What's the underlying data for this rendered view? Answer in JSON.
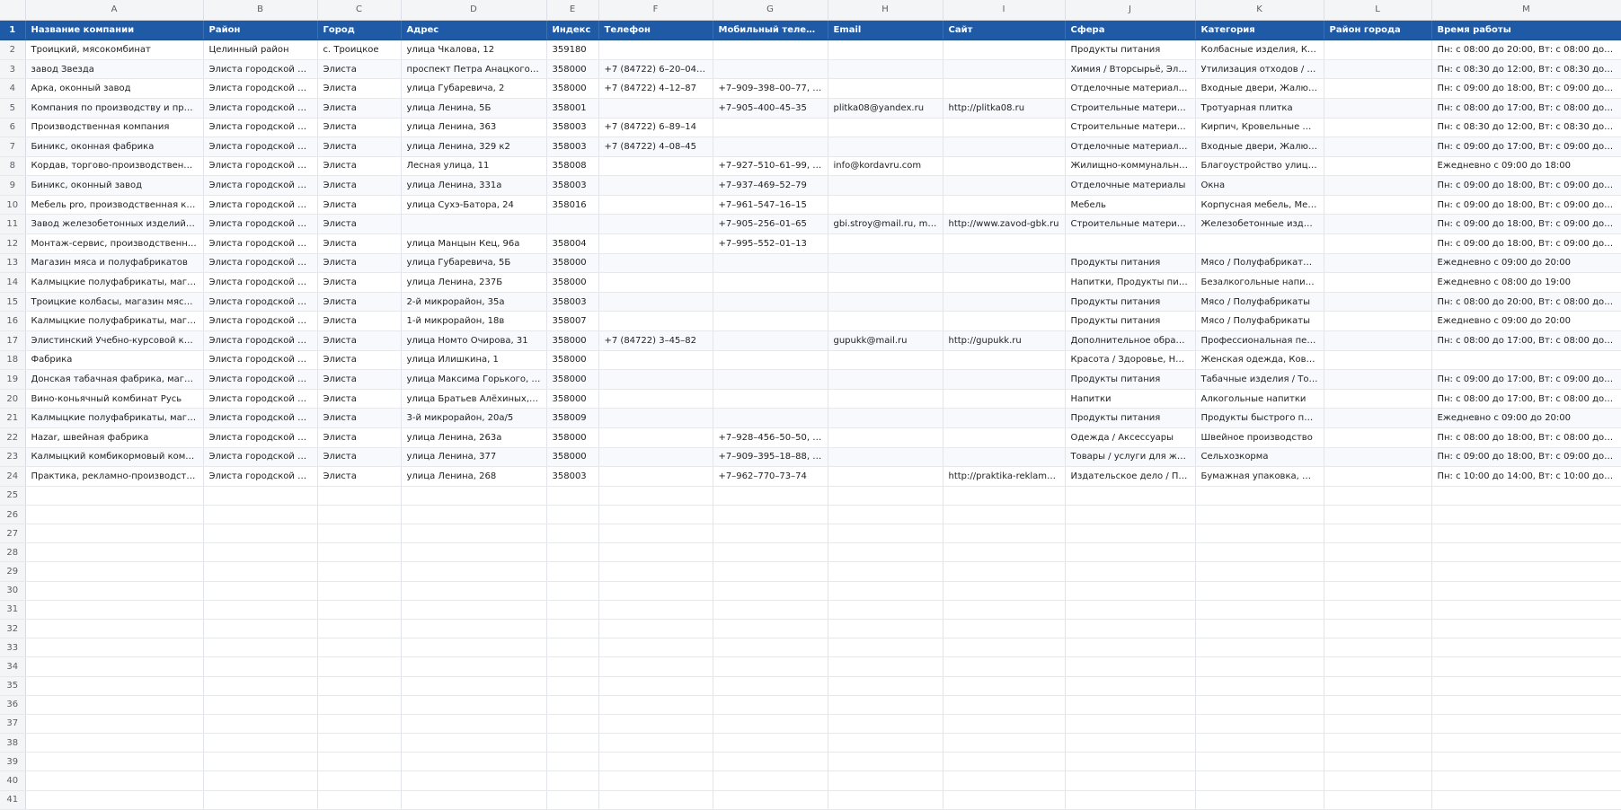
{
  "columns": [
    "A",
    "B",
    "C",
    "D",
    "E",
    "F",
    "G",
    "H",
    "I",
    "J",
    "K",
    "L",
    "M"
  ],
  "header_row": {
    "num": "1",
    "cells": [
      "Название компании",
      "Район",
      "Город",
      "Адрес",
      "Индекс",
      "Телефон",
      "Мобильный телефон",
      "Email",
      "Сайт",
      "Сфера",
      "Категория",
      "Район города",
      "Время работы"
    ]
  },
  "rows": [
    {
      "num": "2",
      "cells": [
        "Троицкий, мясокомбинат",
        "Целинный район",
        "с. Троицкое",
        "улица Чкалова, 12",
        "359180",
        "",
        "",
        "",
        "",
        "Продукты питания",
        "Колбасные изделия, Конд...",
        "",
        "Пн: с 08:00 до 20:00, Вт: с 08:00 до 20:00, С..."
      ]
    },
    {
      "num": "3",
      "cells": [
        "завод Звезда",
        "Элиста городской округ",
        "Элиста",
        "проспект Петра Анацкого, 14",
        "358000",
        "+7 (84722) 6–20–04, +7...",
        "",
        "",
        "",
        "Химия / Вторсырьё, Элект...",
        "Утилизация отходов / Пер...",
        "",
        "Пн: с 08:30 до 12:00, Вт: с 08:30 до 12:00, С..."
      ]
    },
    {
      "num": "4",
      "cells": [
        "Арка, оконный завод",
        "Элиста городской округ",
        "Элиста",
        "улица Губаревича, 2",
        "358000",
        "+7 (84722) 4–12–87",
        "+7–909–398–00–77, +7...",
        "",
        "",
        "Отделочные материалы, П...",
        "Входные двери, Жалюзи, ...",
        "",
        "Пн: с 09:00 до 18:00, Вт: с 09:00 до 18:00, С..."
      ]
    },
    {
      "num": "5",
      "cells": [
        "Компания по производству и продаж...",
        "Элиста городской округ",
        "Элиста",
        "улица Ленина, 5Б",
        "358001",
        "",
        "+7–905–400–45–35",
        "plitka08@yandex.ru",
        "http://plitka08.ru",
        "Строительные материалы ...",
        "Тротуарная плитка",
        "",
        "Пн: с 08:00 до 17:00, Вт: с 08:00 до 17:00, С..."
      ]
    },
    {
      "num": "6",
      "cells": [
        "Производственная компания",
        "Элиста городской округ",
        "Элиста",
        "улица Ленина, 363",
        "358003",
        "+7 (84722) 6–89–14",
        "",
        "",
        "",
        "Строительные материалы ...",
        "Кирпич, Кровельные мате...",
        "",
        "Пн: с 08:30 до 12:00, Вт: с 08:30 до 12:00, С..."
      ]
    },
    {
      "num": "7",
      "cells": [
        "Биникс, оконная фабрика",
        "Элиста городской округ",
        "Элиста",
        "улица Ленина, 329 к2",
        "358003",
        "+7 (84722) 4–08–45",
        "",
        "",
        "",
        "Отделочные материалы, П...",
        "Входные двери, Жалюзи, ...",
        "",
        "Пн: с 09:00 до 17:00, Вт: с 09:00 до 17:00, С..."
      ]
    },
    {
      "num": "8",
      "cells": [
        "Кордав, торгово-производственная ф...",
        "Элиста городской округ",
        "Элиста",
        "Лесная улица, 11",
        "358008",
        "",
        "+7–927–510–61–99, +7...",
        "info@kordavru.com",
        "",
        "Жилищно-коммунальные ...",
        "Благоустройство улиц, Дет...",
        "",
        "Ежедневно с 09:00 до 18:00"
      ]
    },
    {
      "num": "9",
      "cells": [
        "Биникс, оконный завод",
        "Элиста городской округ",
        "Элиста",
        "улица Ленина, 331а",
        "358003",
        "",
        "+7–937–469–52–79",
        "",
        "",
        "Отделочные материалы",
        "Окна",
        "",
        "Пн: с 09:00 до 18:00, Вт: с 09:00 до 18:00, С..."
      ]
    },
    {
      "num": "10",
      "cells": [
        "Мебель pro, производственная комп...",
        "Элиста городской округ",
        "Элиста",
        "улица Сухэ-Батора, 24",
        "358016",
        "",
        "+7–961–547–16–15",
        "",
        "",
        "Мебель",
        "Корпусная мебель, Мебел...",
        "",
        "Пн: с 09:00 до 18:00, Вт: с 09:00 до 18:00, С..."
      ]
    },
    {
      "num": "11",
      "cells": [
        "Завод железобетонных изделий №15",
        "Элиста городской округ",
        "Элиста",
        "",
        "",
        "",
        "+7–905–256–01–65",
        "gbi.stroy@mail.ru, mail...",
        "http://www.zavod-gbk.ru",
        "Строительные материалы ...",
        "Железобетонные изделия",
        "",
        "Пн: с 09:00 до 18:00, Вт: с 09:00 до 18:00, С..."
      ]
    },
    {
      "num": "12",
      "cells": [
        "Монтаж-сервис, производственный ц...",
        "Элиста городской округ",
        "Элиста",
        "улица Манцын Кец, 96а",
        "358004",
        "",
        "+7–995–552–01–13",
        "",
        "",
        "",
        "",
        "",
        "Пн: с 09:00 до 18:00, Вт: с 09:00 до 18:00, С..."
      ]
    },
    {
      "num": "13",
      "cells": [
        "Магазин мяса и полуфабрикатов",
        "Элиста городской округ",
        "Элиста",
        "улица Губаревича, 5Б",
        "358000",
        "",
        "",
        "",
        "",
        "Продукты питания",
        "Мясо / Полуфабрикаты, О...",
        "",
        "Ежедневно с 09:00 до 20:00"
      ]
    },
    {
      "num": "14",
      "cells": [
        "Калмыцкие полуфабрикаты, магазин",
        "Элиста городской округ",
        "Элиста",
        "улица Ленина, 237Б",
        "358000",
        "",
        "",
        "",
        "",
        "Напитки, Продукты питания",
        "Безалкогольные напитки, ...",
        "",
        "Ежедневно с 08:00 до 19:00"
      ]
    },
    {
      "num": "15",
      "cells": [
        "Троицкие колбасы, магазин мяса и п...",
        "Элиста городской округ",
        "Элиста",
        "2-й микрорайон, 35а",
        "358003",
        "",
        "",
        "",
        "",
        "Продукты питания",
        "Мясо / Полуфабрикаты",
        "",
        "Пн: с 08:00 до 20:00, Вт: с 08:00 до 20:00, С..."
      ]
    },
    {
      "num": "16",
      "cells": [
        "Калмыцкие полуфабрикаты, магазин",
        "Элиста городской округ",
        "Элиста",
        "1-й микрорайон, 18в",
        "358007",
        "",
        "",
        "",
        "",
        "Продукты питания",
        "Мясо / Полуфабрикаты",
        "",
        "Ежедневно с 09:00 до 20:00"
      ]
    },
    {
      "num": "17",
      "cells": [
        "Элистинский Учебно-курсовой комб...",
        "Элиста городской округ",
        "Элиста",
        "улица Номто Очирова, 31",
        "358000",
        "+7 (84722) 3–45–82",
        "",
        "gupukk@mail.ru",
        "http://gupukk.ru",
        "Дополнительное образов...",
        "Профессиональная переп...",
        "",
        "Пн: с 08:00 до 17:00, Вт: с 08:00 до 17:00, С..."
      ]
    },
    {
      "num": "18",
      "cells": [
        "Фабрика",
        "Элиста городской округ",
        "Элиста",
        "улица Илишкина, 1",
        "358000",
        "",
        "",
        "",
        "",
        "Красота / Здоровье, Недви...",
        "Женская одежда, Коворки...",
        "",
        ""
      ]
    },
    {
      "num": "19",
      "cells": [
        "Донская табачная фабрика, магазин",
        "Элиста городской округ",
        "Элиста",
        "улица Максима Горького, 20а",
        "358000",
        "",
        "",
        "",
        "",
        "Продукты питания",
        "Табачные изделия / Товар...",
        "",
        "Пн: с 09:00 до 17:00, Вт: с 09:00 до 17:00, С..."
      ]
    },
    {
      "num": "20",
      "cells": [
        "Вино-коньячный комбинат Русь",
        "Элиста городской округ",
        "Элиста",
        "улица Братьев Алёхиных, 29а",
        "358000",
        "",
        "",
        "",
        "",
        "Напитки",
        "Алкогольные напитки",
        "",
        "Пн: с 08:00 до 17:00, Вт: с 08:00 до 17:00, С..."
      ]
    },
    {
      "num": "21",
      "cells": [
        "Калмыцкие полуфабрикаты, магазин",
        "Элиста городской округ",
        "Элиста",
        "3-й микрорайон, 20а/5",
        "358009",
        "",
        "",
        "",
        "",
        "Продукты питания",
        "Продукты быстрого приго...",
        "",
        "Ежедневно с 09:00 до 20:00"
      ]
    },
    {
      "num": "22",
      "cells": [
        "Hazar, швейная фабрика",
        "Элиста городской округ",
        "Элиста",
        "улица Ленина, 263а",
        "358000",
        "",
        "+7–928–456–50–50, +7...",
        "",
        "",
        "Одежда / Аксессуары",
        "Швейное производство",
        "",
        "Пн: с 08:00 до 18:00, Вт: с 08:00 до 18:00, С..."
      ]
    },
    {
      "num": "23",
      "cells": [
        "Калмыцкий комбикормовый комбин...",
        "Элиста городской округ",
        "Элиста",
        "улица Ленина, 377",
        "358000",
        "",
        "+7–909–395–18–88, +7...",
        "",
        "",
        "Товары / услуги для живот...",
        "Сельхозкорма",
        "",
        "Пн: с 09:00 до 18:00, Вт: с 09:00 до 18:00, С..."
      ]
    },
    {
      "num": "24",
      "cells": [
        "Практика, рекламно-производствен...",
        "Элиста городской округ",
        "Элиста",
        "улица Ленина, 268",
        "358003",
        "",
        "+7–962–770–73–74",
        "",
        "http://praktika-reklama.ru",
        "Издательское дело / Поли...",
        "Бумажная упаковка, Деко...",
        "",
        "Пн: с 10:00 до 14:00, Вт: с 10:00 до 14:00, С..."
      ]
    }
  ],
  "empty_rows": [
    "25",
    "26",
    "27",
    "28",
    "29",
    "30",
    "31",
    "32",
    "33",
    "34",
    "35",
    "36",
    "37",
    "38",
    "39",
    "40",
    "41"
  ]
}
